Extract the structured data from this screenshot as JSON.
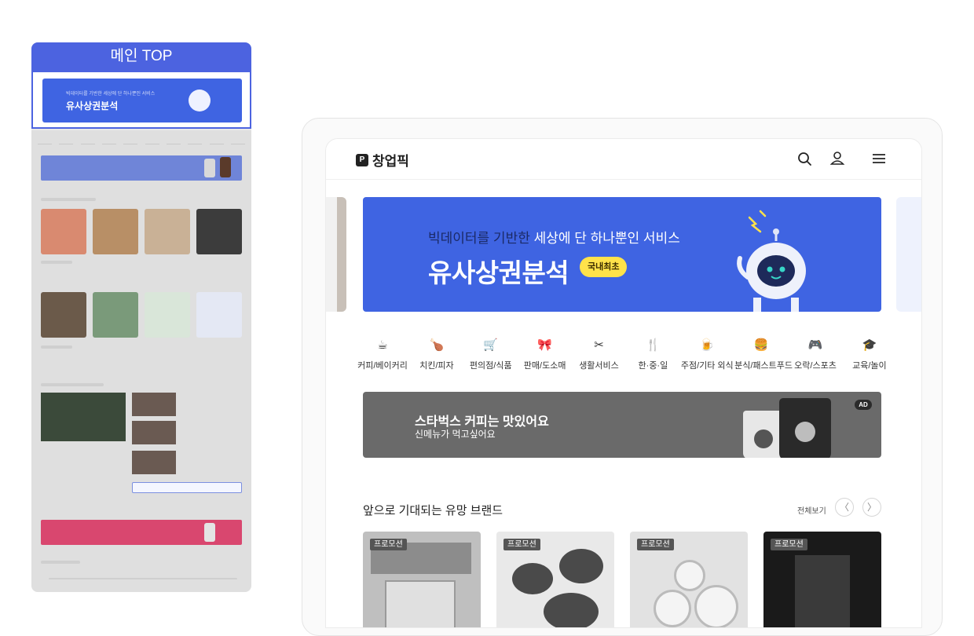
{
  "thumbnail": {
    "header": "메인 TOP",
    "banner_sub": "빅데이터를 기반한 세상에 단 하나뿐인 서비스",
    "banner_title": "유사상권분석"
  },
  "app": {
    "logo_text": "창업픽"
  },
  "header_icons": [
    "search-icon",
    "user-icon",
    "menu-icon"
  ],
  "hero": {
    "sub_prefix": "빅데이터를 기반한 ",
    "sub_highlight": "세상에 단 하나뿐인 서비스",
    "title": "유사상권분석",
    "badge": "국내최초"
  },
  "categories": [
    {
      "label": "커피/베이커리",
      "icon": "coffee-icon",
      "glyph": "☕"
    },
    {
      "label": "치킨/피자",
      "icon": "chicken-icon",
      "glyph": "🍗"
    },
    {
      "label": "편의점/식품",
      "icon": "store-icon",
      "glyph": "🛒"
    },
    {
      "label": "판매/도소매",
      "icon": "shop-icon",
      "glyph": "🎀"
    },
    {
      "label": "생활서비스",
      "icon": "tools-icon",
      "glyph": "✂"
    },
    {
      "label": "한·중·일",
      "icon": "utensils-icon",
      "glyph": "🍴"
    },
    {
      "label": "주점/기타 외식",
      "icon": "drink-icon",
      "glyph": "🍺"
    },
    {
      "label": "분식/패스트푸드",
      "icon": "fastfood-icon",
      "glyph": "🍔"
    },
    {
      "label": "오락/스포츠",
      "icon": "game-icon",
      "glyph": "🎮"
    },
    {
      "label": "교육/놀이",
      "icon": "education-icon",
      "glyph": "🎓"
    }
  ],
  "ad": {
    "title": "스타벅스 커피는 맛있어요",
    "subtitle": "신메뉴가 먹고싶어요",
    "tag": "AD"
  },
  "section": {
    "title": "앞으로 기대되는 유망 브랜드",
    "more": "전체보기",
    "prev": "〈",
    "next": "〉"
  },
  "cards": [
    {
      "badge": "프로모션"
    },
    {
      "badge": "프로모션"
    },
    {
      "badge": "프로모션"
    },
    {
      "badge": "프로모션"
    }
  ],
  "colors": {
    "primary": "#3f64e2",
    "thumb_header": "#4c63e0",
    "badge_yellow": "#ffe24a",
    "ad_gray": "#6a6a6a",
    "pink_ad": "#d9476f"
  }
}
